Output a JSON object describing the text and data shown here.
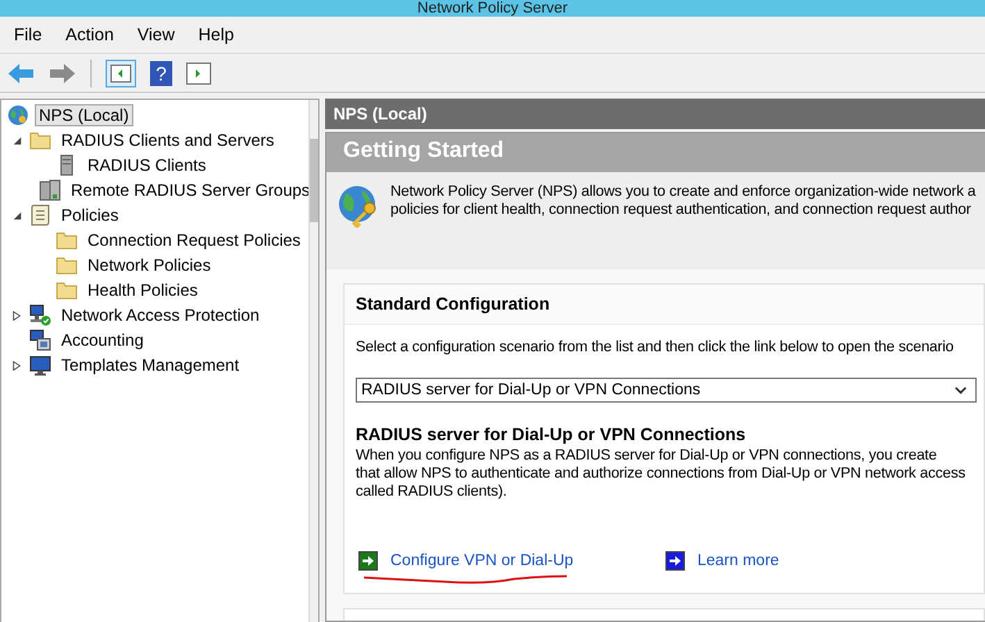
{
  "window": {
    "title": "Network Policy Server"
  },
  "menu": [
    "File",
    "Action",
    "View",
    "Help"
  ],
  "toolbar": {
    "help_glyph": "?"
  },
  "tree": [
    {
      "label": "NPS (Local)",
      "kind": "globe",
      "expandable": false,
      "selected": true,
      "children": [
        {
          "label": "RADIUS Clients and Servers",
          "kind": "folder",
          "expandable": true,
          "expanded": true,
          "selected": false,
          "children": [
            {
              "label": "RADIUS Clients",
              "kind": "server",
              "expandable": false,
              "selected": false
            },
            {
              "label": "Remote RADIUS Server Groups",
              "kind": "servers",
              "expandable": false,
              "selected": false
            }
          ]
        },
        {
          "label": "Policies",
          "kind": "scroll",
          "expandable": true,
          "expanded": true,
          "selected": false,
          "children": [
            {
              "label": "Connection Request Policies",
              "kind": "folder",
              "expandable": false,
              "selected": false
            },
            {
              "label": "Network Policies",
              "kind": "folder",
              "expandable": false,
              "selected": false
            },
            {
              "label": "Health Policies",
              "kind": "folder",
              "expandable": false,
              "selected": false
            }
          ]
        },
        {
          "label": "Network Access Protection",
          "kind": "network-check",
          "expandable": true,
          "expanded": false,
          "selected": false
        },
        {
          "label": "Accounting",
          "kind": "network",
          "expandable": false,
          "selected": false
        },
        {
          "label": "Templates Management",
          "kind": "monitor",
          "expandable": true,
          "expanded": false,
          "selected": false
        }
      ]
    }
  ],
  "content": {
    "header": "NPS (Local)",
    "section_title": "Getting Started",
    "intro": [
      "Network Policy Server (NPS) allows you to create and enforce organization-wide network a",
      "policies for client health, connection request authentication, and connection request author"
    ],
    "standard": {
      "title": "Standard Configuration",
      "instruction": "Select a configuration scenario from the list and then click the link below to open the scenario",
      "scenario": "RADIUS server for Dial-Up or VPN Connections",
      "scenario_title": "RADIUS server for Dial-Up or VPN Connections",
      "scenario_text": [
        "When you configure NPS as a RADIUS server for Dial-Up or VPN connections, you create",
        "that allow NPS to authenticate and authorize connections from Dial-Up or VPN network access",
        "called RADIUS clients)."
      ],
      "links": [
        {
          "label": "Configure VPN or Dial-Up",
          "color": "#1a7a1a",
          "underlined": true
        },
        {
          "label": "Learn more",
          "color": "#1a1ae0",
          "underlined": false
        }
      ]
    }
  }
}
